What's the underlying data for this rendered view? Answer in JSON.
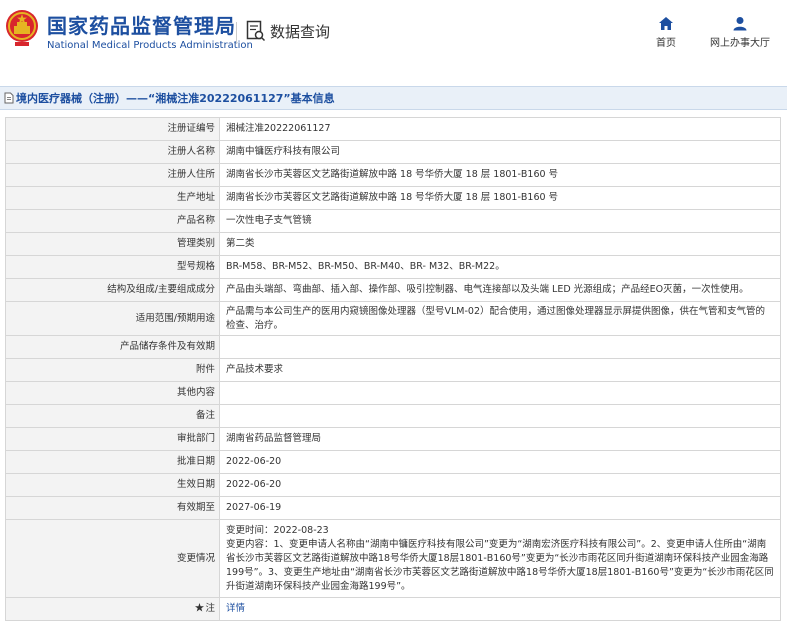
{
  "header": {
    "org_name_cn": "国家药品监督管理局",
    "org_name_en": "National Medical Products Administration",
    "data_query_label": "数据查询",
    "nav_home_label": "首页",
    "nav_hall_label": "网上办事大厅"
  },
  "title_bar": {
    "text": "境内医疗器械（注册）——“湘械注准20222061127”基本信息"
  },
  "rows": [
    {
      "label": "注册证编号",
      "value": "湘械注准20222061127"
    },
    {
      "label": "注册人名称",
      "value": "湖南中镛医疗科技有限公司"
    },
    {
      "label": "注册人住所",
      "value": "湖南省长沙市芙蓉区文艺路街道解放中路 18 号华侨大厦 18 层 1801-B160 号"
    },
    {
      "label": "生产地址",
      "value": "湖南省长沙市芙蓉区文艺路街道解放中路 18 号华侨大厦 18 层 1801-B160 号"
    },
    {
      "label": "产品名称",
      "value": "一次性电子支气管镜"
    },
    {
      "label": "管理类别",
      "value": "第二类"
    },
    {
      "label": "型号规格",
      "value": "BR-M58、BR-M52、BR-M50、BR-M40、BR- M32、BR-M22。"
    },
    {
      "label": "结构及组成/主要组成成分",
      "value": "产品由头端部、弯曲部、插入部、操作部、吸引控制器、电气连接部以及头端 LED 光源组成；产品经EO灭菌，一次性使用。"
    },
    {
      "label": "适用范围/预期用途",
      "value": "产品需与本公司生产的医用内窥镜图像处理器（型号VLM-02）配合使用，通过图像处理器显示屏提供图像，供在气管和支气管的检查、治疗。"
    },
    {
      "label": "产品储存条件及有效期",
      "value": ""
    },
    {
      "label": "附件",
      "value": "产品技术要求"
    },
    {
      "label": "其他内容",
      "value": ""
    },
    {
      "label": "备注",
      "value": ""
    },
    {
      "label": "审批部门",
      "value": "湖南省药品监督管理局"
    },
    {
      "label": "批准日期",
      "value": "2022-06-20"
    },
    {
      "label": "生效日期",
      "value": "2022-06-20"
    },
    {
      "label": "有效期至",
      "value": "2027-06-19"
    }
  ],
  "change_info": {
    "label": "变更情况",
    "time_line": "变更时间：2022-08-23",
    "content": "变更内容：1、变更申请人名称由“湖南中镛医疗科技有限公司”变更为“湖南宏济医疗科技有限公司”。2、变更申请人住所由“湖南省长沙市芙蓉区文艺路街道解放中路18号华侨大厦18层1801-B160号”变更为“长沙市雨花区同升街道湖南环保科技产业园金海路199号”。3、变更生产地址由“湖南省长沙市芙蓉区文艺路街道解放中路18号华侨大厦18层1801-B160号”变更为“长沙市雨花区同升街道湖南环保科技产业园金海路199号”。"
  },
  "note_row": {
    "label": "注",
    "link_text": "详情"
  },
  "colors": {
    "brand_blue": "#1d4fa0",
    "emblem_red": "#d8262d",
    "emblem_gold": "#e6b422",
    "label_bg": "#f3f3f3",
    "title_bar_bg": "#e9f0f8"
  },
  "icons": [
    "national-emblem",
    "data-query-icon",
    "home-icon",
    "user-icon",
    "document-icon",
    "required-star-icon"
  ]
}
